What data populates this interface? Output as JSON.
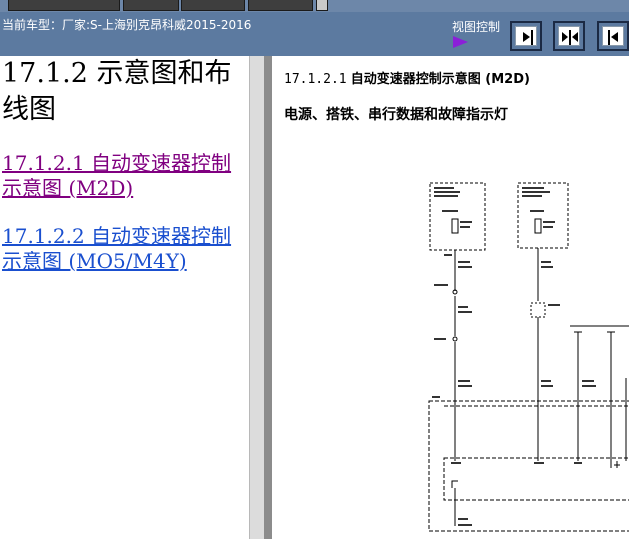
{
  "header": {
    "vehicle_info": "当前车型：厂家:S-上海别克昂科威2015-2016",
    "view_control_label": "视图控制",
    "view_buttons": [
      "left-panel-icon",
      "split-panel-icon",
      "right-panel-icon"
    ]
  },
  "nav": {
    "section_title": "17.1.2 示意图和布线图",
    "links": [
      "17.1.2.1 自动变速器控制示意图 (M2D)",
      "17.1.2.2 自动变速器控制示意图 (MO5/M4Y)"
    ]
  },
  "content": {
    "title_number": "17.1.2.1",
    "title_text": "自动变速器控制示意图 (M2D)",
    "subtitle": "电源、搭铁、串行数据和故障指示灯"
  },
  "colors": {
    "header_bg": "#5c7aa0",
    "visited_link": "#800080",
    "link": "#1a4fcf",
    "triangle": "#8b1fd8"
  }
}
